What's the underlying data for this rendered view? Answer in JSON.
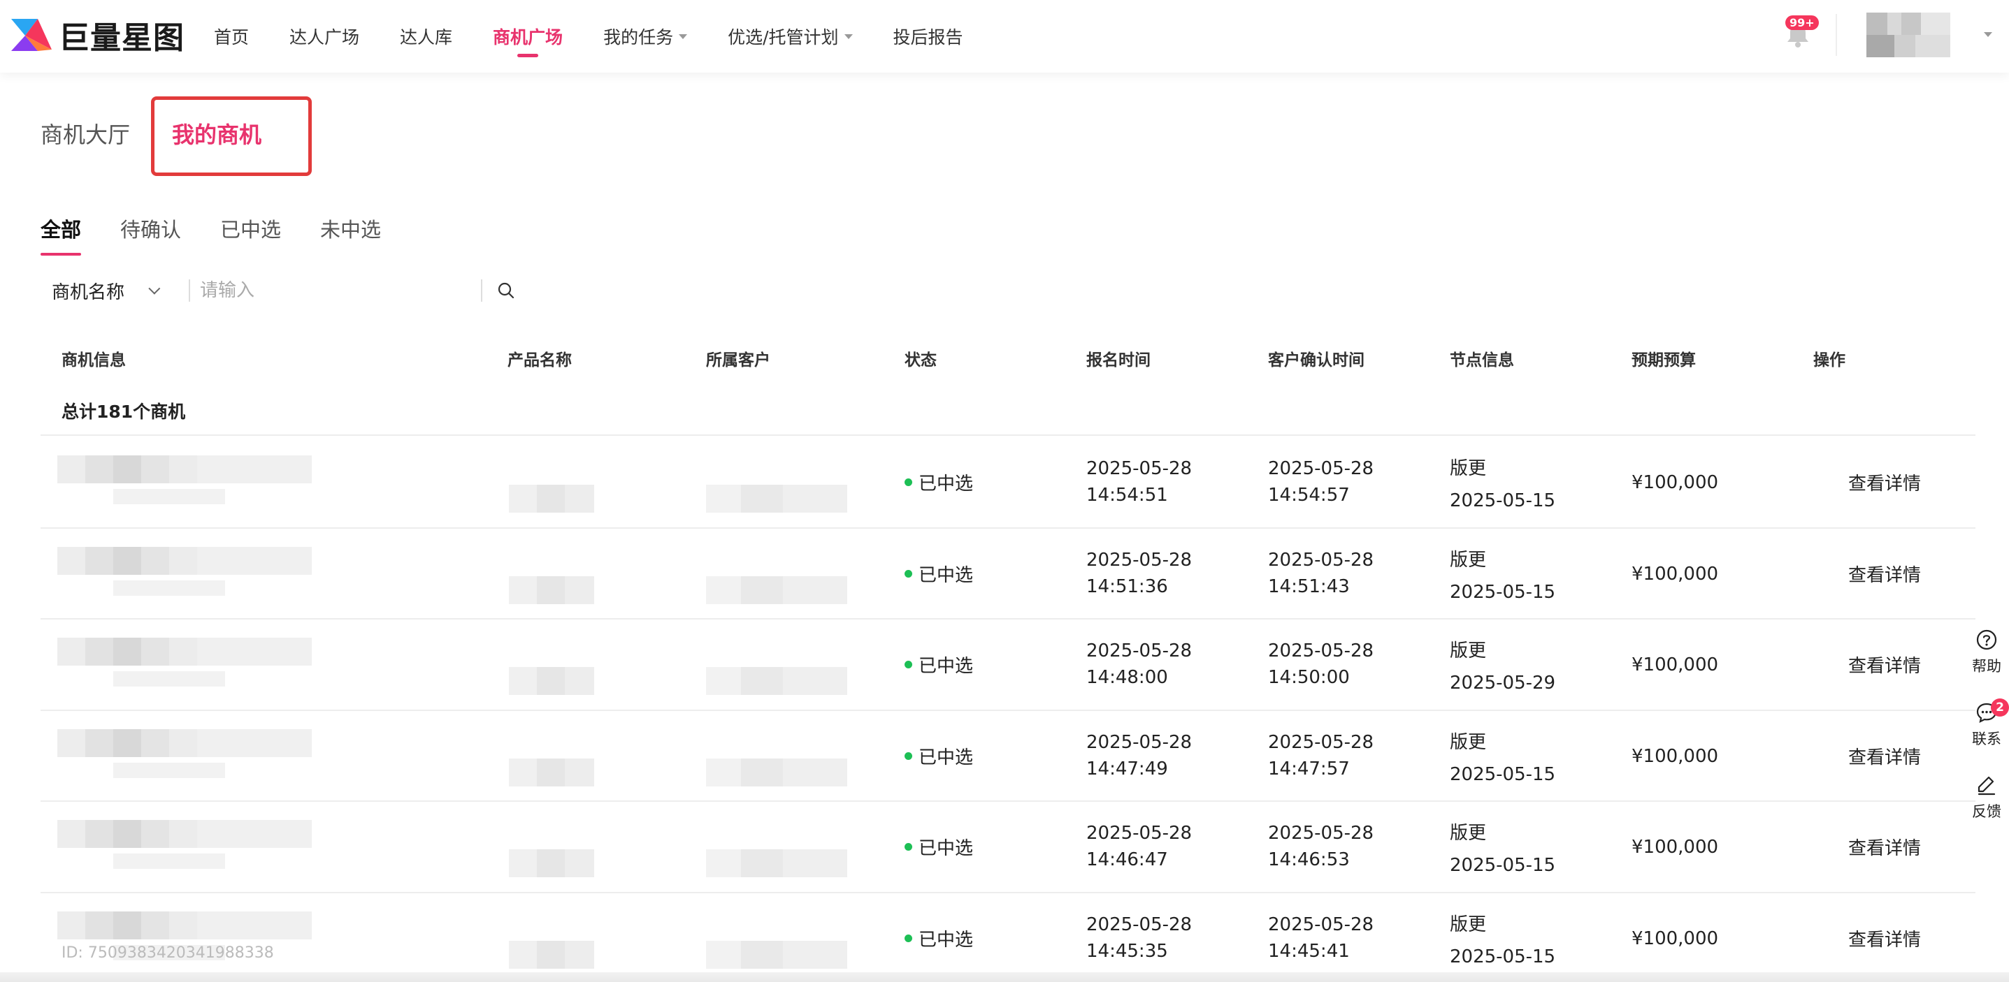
{
  "app": {
    "logo_text": "巨量星图",
    "notification_badge": "99+",
    "brand_color": "#e8336d"
  },
  "nav": {
    "items": [
      {
        "label": "首页",
        "active": false,
        "dropdown": false
      },
      {
        "label": "达人广场",
        "active": false,
        "dropdown": false
      },
      {
        "label": "达人库",
        "active": false,
        "dropdown": false
      },
      {
        "label": "商机广场",
        "active": true,
        "dropdown": false
      },
      {
        "label": "我的任务",
        "active": false,
        "dropdown": true
      },
      {
        "label": "优选/托管计划",
        "active": false,
        "dropdown": true
      },
      {
        "label": "投后报告",
        "active": false,
        "dropdown": false
      }
    ]
  },
  "page_tabs": {
    "hall": "商机大厅",
    "mine": "我的商机"
  },
  "sub_tabs": [
    "全部",
    "待确认",
    "已中选",
    "未中选"
  ],
  "search": {
    "field_select": "商机名称",
    "placeholder": "请输入"
  },
  "table": {
    "headers": [
      "商机信息",
      "产品名称",
      "所属客户",
      "状态",
      "报名时间",
      "客户确认时间",
      "节点信息",
      "预期预算",
      "操作"
    ],
    "total_label": "总计181个商机",
    "rows": [
      {
        "status": "已中选",
        "signup_date": "2025-05-28",
        "signup_time": "14:54:51",
        "confirm_date": "2025-05-28",
        "confirm_time": "14:54:57",
        "node_label": "版更",
        "node_date": "2025-05-15",
        "budget": "¥100,000",
        "action": "查看详情"
      },
      {
        "status": "已中选",
        "signup_date": "2025-05-28",
        "signup_time": "14:51:36",
        "confirm_date": "2025-05-28",
        "confirm_time": "14:51:43",
        "node_label": "版更",
        "node_date": "2025-05-15",
        "budget": "¥100,000",
        "action": "查看详情"
      },
      {
        "status": "已中选",
        "signup_date": "2025-05-28",
        "signup_time": "14:48:00",
        "confirm_date": "2025-05-28",
        "confirm_time": "14:50:00",
        "node_label": "版更",
        "node_date": "2025-05-29",
        "budget": "¥100,000",
        "action": "查看详情"
      },
      {
        "status": "已中选",
        "signup_date": "2025-05-28",
        "signup_time": "14:47:49",
        "confirm_date": "2025-05-28",
        "confirm_time": "14:47:57",
        "node_label": "版更",
        "node_date": "2025-05-15",
        "budget": "¥100,000",
        "action": "查看详情"
      },
      {
        "status": "已中选",
        "signup_date": "2025-05-28",
        "signup_time": "14:46:47",
        "confirm_date": "2025-05-28",
        "confirm_time": "14:46:53",
        "node_label": "版更",
        "node_date": "2025-05-15",
        "budget": "¥100,000",
        "action": "查看详情"
      },
      {
        "status": "已中选",
        "signup_date": "2025-05-28",
        "signup_time": "14:45:35",
        "confirm_date": "2025-05-28",
        "confirm_time": "14:45:41",
        "node_label": "版更",
        "node_date": "2025-05-15",
        "budget": "¥100,000",
        "action": "查看详情"
      }
    ],
    "last_row_id": "ID: 7509383420341988338"
  },
  "side_float": {
    "help": "帮助",
    "contact": "联系",
    "contact_badge": "2",
    "feedback": "反馈"
  }
}
